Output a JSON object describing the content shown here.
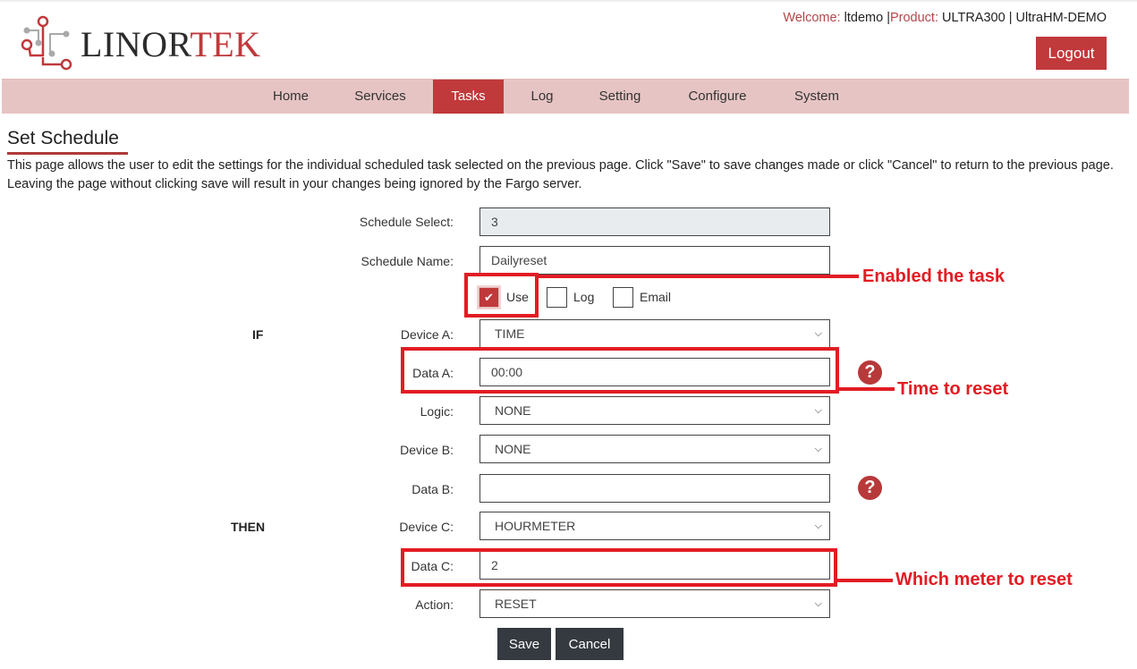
{
  "brand": {
    "name_dark": "LINOR",
    "name_red": "TEK",
    "accent": "#c0393b"
  },
  "header": {
    "welcome_key": "Welcome:",
    "user": "ltdemo",
    "product_key": "Product:",
    "product": "ULTRA300",
    "device": "UltraHM-DEMO",
    "separator": "|",
    "logout_label": "Logout"
  },
  "nav": {
    "items": [
      {
        "label": "Home"
      },
      {
        "label": "Services"
      },
      {
        "label": "Tasks",
        "active": true
      },
      {
        "label": "Log"
      },
      {
        "label": "Setting"
      },
      {
        "label": "Configure"
      },
      {
        "label": "System"
      }
    ]
  },
  "page": {
    "title": "Set Schedule",
    "description": "This page allows the user to edit the settings for the individual scheduled task selected on the previous page. Click \"Save\" to save changes made or click \"Cancel\" to return to the previous page. Leaving the page without clicking save will result in your changes being ignored by the Fargo server."
  },
  "form": {
    "schedule_select": {
      "label": "Schedule Select:",
      "value": "3"
    },
    "schedule_name": {
      "label": "Schedule Name:",
      "value": "Dailyreset"
    },
    "checkboxes": [
      {
        "label": "Use",
        "checked": true
      },
      {
        "label": "Log",
        "checked": false
      },
      {
        "label": "Email",
        "checked": false
      }
    ],
    "if_label": "IF",
    "then_label": "THEN",
    "device_a": {
      "label": "Device A:",
      "value": "TIME"
    },
    "data_a": {
      "label": "Data A:",
      "value": "00:00"
    },
    "logic": {
      "label": "Logic:",
      "value": "NONE"
    },
    "device_b": {
      "label": "Device B:",
      "value": "NONE"
    },
    "data_b": {
      "label": "Data B:",
      "value": ""
    },
    "device_c": {
      "label": "Device C:",
      "value": "HOURMETER"
    },
    "data_c": {
      "label": "Data C:",
      "value": "2"
    },
    "action": {
      "label": "Action:",
      "value": "RESET"
    },
    "save_label": "Save",
    "cancel_label": "Cancel",
    "help_glyph": "?"
  },
  "annotations": {
    "enabled": "Enabled the task",
    "time": "Time to reset",
    "meter": "Which meter to reset",
    "color": "#e21c24"
  }
}
